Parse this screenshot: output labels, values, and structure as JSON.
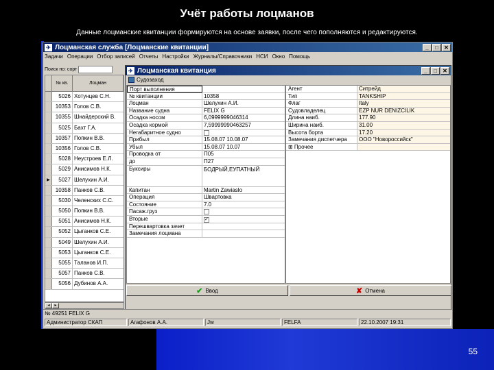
{
  "slide": {
    "title": "Учёт работы лоцманов",
    "subtitle": "Данные лоцманские квитанции формируются на основе заявки, после чего пополняются и редактируются.",
    "page_number": "55"
  },
  "app": {
    "title": "Лоцманская служба  [Лоцманские квитанции]",
    "menu": [
      "Задачи",
      "Операции",
      "Отбор записей",
      "Отчеты",
      "Настройки",
      "Журналы/Справочники",
      "НСИ",
      "Окно",
      "Помощь"
    ],
    "search_label": "Поиск по: сорт",
    "list_headers": [
      "№ кв.",
      "Лоцман"
    ],
    "list_rows": [
      {
        "num": "5026",
        "name": "Хотунцев С.Н."
      },
      {
        "num": "10353",
        "name": "Голов С.В."
      },
      {
        "num": "10355",
        "name": "Шнайдерский В."
      },
      {
        "num": "5025",
        "name": "Бахт Г.А."
      },
      {
        "num": "10357",
        "name": "Попкин В.В."
      },
      {
        "num": "10356",
        "name": "Голов С.В."
      },
      {
        "num": "5028",
        "name": "Неустроев Е.Л."
      },
      {
        "num": "5029",
        "name": "Анисимов Н.К."
      },
      {
        "num": "5027",
        "name": "Шелухин А.И."
      },
      {
        "num": "10358",
        "name": "Панков С.В."
      },
      {
        "num": "5030",
        "name": "Челенских С.С."
      },
      {
        "num": "5050",
        "name": "Попкин В.В."
      },
      {
        "num": "5051",
        "name": "Анисимов Н.К."
      },
      {
        "num": "5052",
        "name": "Цыганков С.Е."
      },
      {
        "num": "5049",
        "name": "Шелухин А.И."
      },
      {
        "num": "5053",
        "name": "Цыганков С.Е."
      },
      {
        "num": "5055",
        "name": "Таланов И.П."
      },
      {
        "num": "5057",
        "name": "Панков С.В."
      },
      {
        "num": "5056",
        "name": "Дубинов А.А."
      }
    ],
    "list_selected_index": 8,
    "status_record": "№ 49251  FELIX G",
    "statusbar": [
      "Администратор СКАП",
      "Агафонов А.А.",
      "Jw",
      "FELFA",
      "22.10.2007 19:31"
    ]
  },
  "dialog": {
    "title": "Лоцманская квитанция",
    "toolbar_label": "Судозаход",
    "left_fields": [
      {
        "key": "Порт выполнения",
        "value": ""
      },
      {
        "key": "№ квитанции",
        "value": "10358"
      },
      {
        "key": "Лоцман",
        "value": "Шелухин А.И."
      },
      {
        "key": "Название судна",
        "value": "FELIX G"
      },
      {
        "key": "Осадка носом",
        "value": "6,0999999046314"
      },
      {
        "key": "Осадка кормой",
        "value": "7,59999990463257"
      },
      {
        "key": "Негабаритное судно",
        "value": "",
        "check": ""
      },
      {
        "key": "Прибыл",
        "value": "15.08.07 10.08.07"
      },
      {
        "key": "Убыл",
        "value": "15.08.07 10.07"
      },
      {
        "key": "Проводка от",
        "value": "П05"
      },
      {
        "key": "до",
        "value": "П27"
      },
      {
        "key": "Буксиры",
        "value": "БОДРЫЙ,ЕУПАТНЫЙ"
      },
      {
        "key": "Капитан",
        "value": "Martin Zawiaslo"
      },
      {
        "key": "Операция",
        "value": "Швартовка"
      },
      {
        "key": "Состояние",
        "value": "7.0"
      },
      {
        "key": "Пасаж.груз",
        "value": "",
        "check": ""
      },
      {
        "key": "Вторые",
        "value": "",
        "check": "✓"
      },
      {
        "key": "Перешвартовка зачет",
        "value": ""
      },
      {
        "key": "Замечания лоцмана",
        "value": ""
      }
    ],
    "right_fields": [
      {
        "key": "Агент",
        "value": "Ситрейд"
      },
      {
        "key": "Тип",
        "value": "TANKSHIP"
      },
      {
        "key": "Флаг",
        "value": "Italy"
      },
      {
        "key": "Судовладелец",
        "value": "EZP NUR DENIZCILIK"
      },
      {
        "key": "Длина наиб.",
        "value": "177.90"
      },
      {
        "key": "Ширина наиб.",
        "value": "31.00"
      },
      {
        "key": "Высота борта",
        "value": "17.20"
      },
      {
        "key": "Замечания диспетчера",
        "value": "ООО \"Новороссийск\""
      },
      {
        "key": "⊞ Прочее",
        "value": ""
      }
    ],
    "ok_label": "Ввод",
    "cancel_label": "Отмена"
  },
  "colors": {
    "titlebar_start": "#0a246a",
    "titlebar_end": "#3a6ea5",
    "accent_blue": "#0b1fc8",
    "window_gray": "#d4d0c8"
  }
}
